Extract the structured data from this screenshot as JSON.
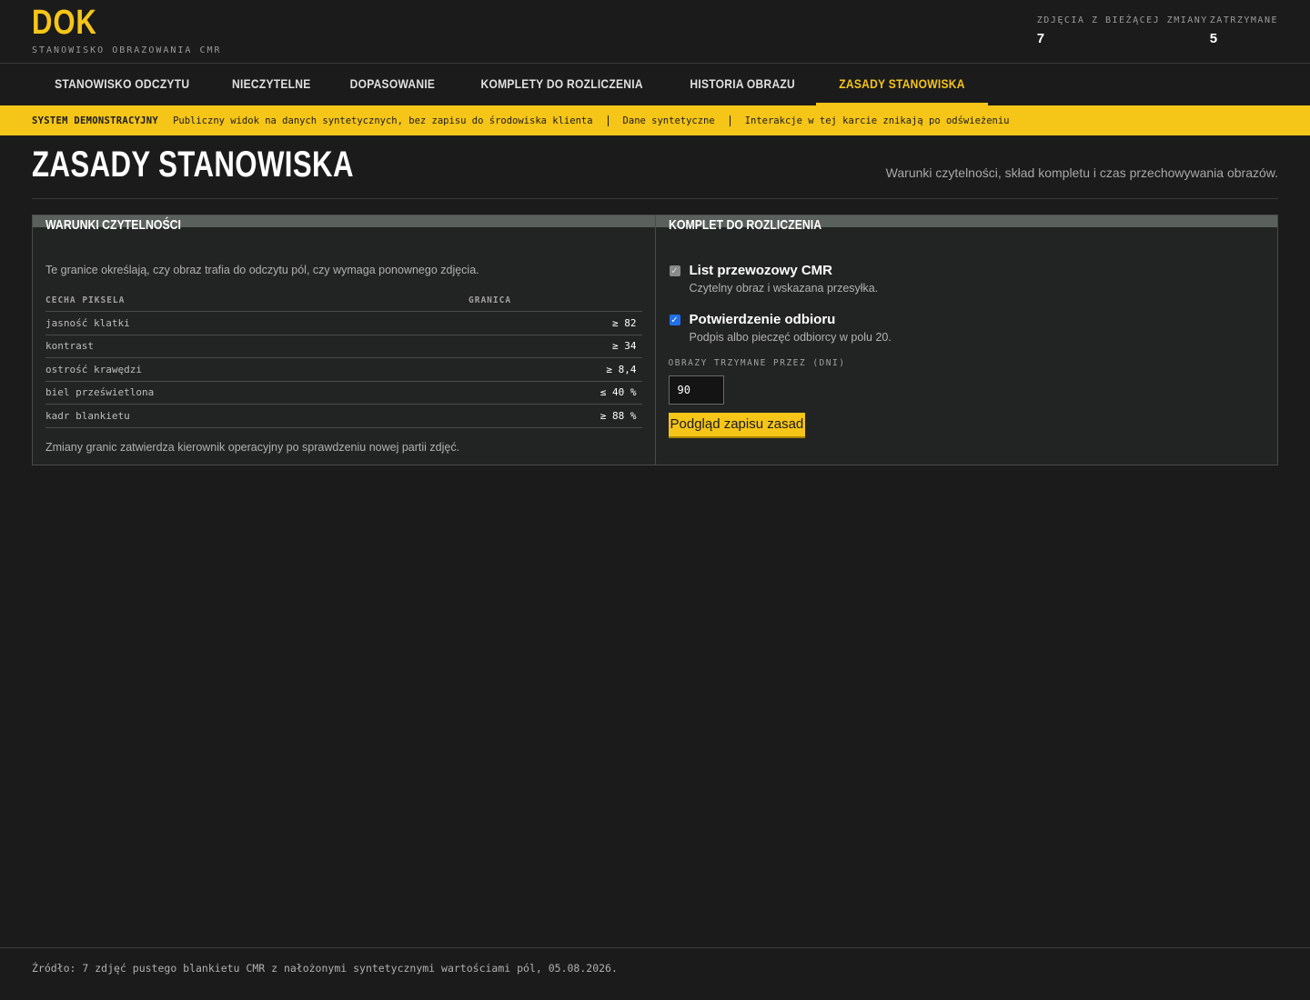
{
  "brand": {
    "logo": "DOK",
    "subtitle": "STANOWISKO OBRAZOWANIA CMR"
  },
  "stats": [
    {
      "label": "ZDJĘCIA Z BIEŻĄCEJ ZMIANY",
      "value": "7"
    },
    {
      "label": "ZATRZYMANE",
      "value": "5"
    }
  ],
  "tabs": [
    {
      "label": "STANOWISKO ODCZYTU"
    },
    {
      "label": "NIECZYTELNE"
    },
    {
      "label": "DOPASOWANIE"
    },
    {
      "label": "KOMPLETY DO ROZLICZENIA"
    },
    {
      "label": "HISTORIA OBRAZU"
    },
    {
      "label": "ZASADY STANOWISKA"
    }
  ],
  "banner": {
    "tag": "SYSTEM DEMONSTRACYJNY",
    "items": [
      "Publiczny widok na danych syntetycznych, bez zapisu do środowiska klienta",
      "Dane syntetyczne",
      "Interakcje w tej karcie znikają po odświeżeniu"
    ]
  },
  "page": {
    "title": "ZASADY STANOWISKA",
    "description": "Warunki czytelności, skład kompletu i czas przechowywania obrazów."
  },
  "readability": {
    "title": "WARUNKI CZYTELNOŚCI",
    "lead": "Te granice określają, czy obraz trafia do odczytu pól, czy wymaga ponownego zdjęcia.",
    "columns": [
      "CECHA PIKSELA",
      "GRANICA"
    ],
    "rows": [
      {
        "feature": "jasność klatki",
        "limit": "≥ 82"
      },
      {
        "feature": "kontrast",
        "limit": "≥ 34"
      },
      {
        "feature": "ostrość krawędzi",
        "limit": "≥ 8,4"
      },
      {
        "feature": "biel prześwietlona",
        "limit": "≤ 40 %"
      },
      {
        "feature": "kadr blankietu",
        "limit": "≥ 88 %"
      }
    ],
    "note": "Zmiany granic zatwierdza kierownik operacyjny po sprawdzeniu nowej partii zdjęć."
  },
  "settlement": {
    "title": "KOMPLET DO ROZLICZENIA",
    "items": [
      {
        "label": "List przewozowy CMR",
        "desc": "Czytelny obraz i wskazana przesyłka.",
        "checked": true,
        "disabled": true
      },
      {
        "label": "Potwierdzenie odbioru",
        "desc": "Podpis albo pieczęć odbiorcy w polu 20.",
        "checked": true,
        "disabled": false
      }
    ],
    "retention_label": "OBRAZY TRZYMANE PRZEZ (DNI)",
    "retention_value": "90",
    "preview_button": "Podgląd zapisu zasad"
  },
  "footer": {
    "source": "Źródło: 7 zdjęć pustego blankietu CMR z nałożonymi syntetycznymi wartościami pól, 05.08.2026."
  },
  "icons": {
    "check": "check-icon"
  },
  "colors": {
    "accent": "#f5c518",
    "background": "#1b1b1b",
    "panel": "#222423",
    "checkbox": "#1f6feb"
  }
}
